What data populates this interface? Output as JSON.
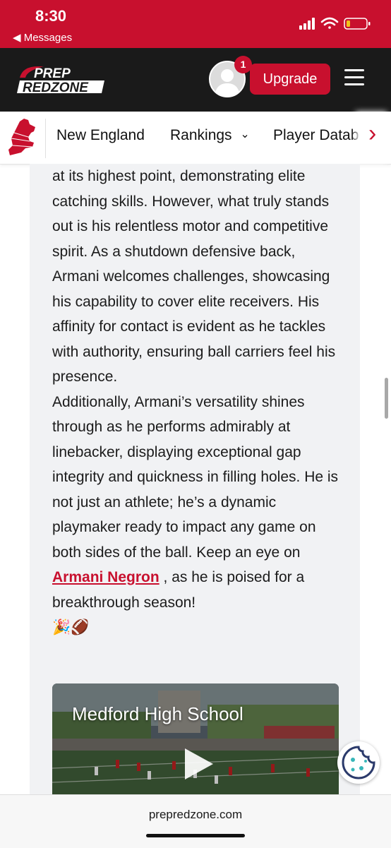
{
  "status_bar": {
    "time": "8:30",
    "back_label": "◀ Messages"
  },
  "header": {
    "logo_line1": "PREP",
    "logo_line2": "REDZONE",
    "notification_count": "1",
    "upgrade_label": "Upgrade"
  },
  "nav": {
    "items": [
      "New England",
      "Rankings",
      "Player Datab"
    ],
    "rankings_caret": "⌄",
    "next_arrow": "›"
  },
  "article": {
    "paragraph1": "at its highest point, demonstrating elite catching skills. However, what truly stands out is his relentless motor and competitive spirit. As a shutdown defensive back, Armani welcomes challenges, showcasing his capability to cover elite receivers. His affinity for contact is evident as he tackles with authority, ensuring ball carriers feel his presence.",
    "paragraph2_before_link": "Additionally, Armani’s versatility shines through as he performs admirably at linebacker, displaying exceptional gap integrity and quickness in filling holes. He is not just an athlete; he’s a dynamic playmaker ready to impact any game on both sides of the ball. Keep an eye on ",
    "player_link": "Armani Negron",
    "paragraph2_after_link": " , as he is poised for a breakthrough season!",
    "emoji": "🎉🏈"
  },
  "video": {
    "title": "Medford High School"
  },
  "browser": {
    "url": "prepredzone.com"
  },
  "colors": {
    "brand_red": "#c8102e",
    "header_dark": "#1a1a1a"
  }
}
